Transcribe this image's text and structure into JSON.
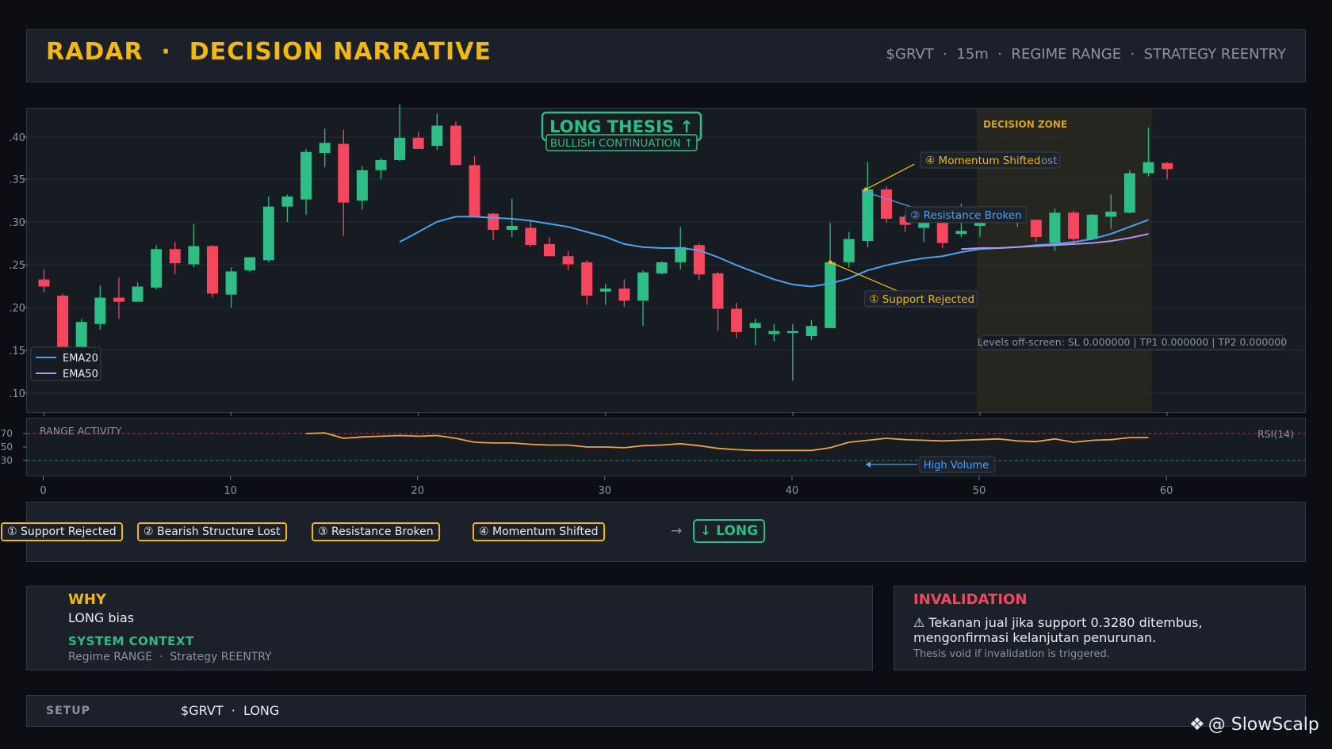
{
  "header": {
    "title": "RADAR  ·  DECISION NARRATIVE",
    "meta": "$GRVT  ·  15m  ·  REGIME RANGE  ·  STRATEGY REENTRY"
  },
  "colors": {
    "bull": "#2ebd85",
    "bear": "#f6465d",
    "ema20": "#4aa3f0",
    "ema50": "#b694f5",
    "accent": "#f0b90b",
    "rsi": "#f0a23c"
  },
  "chart_data": [
    {
      "type": "candlestick",
      "x_ticks": [
        "0",
        "10",
        "20",
        "30",
        "40",
        "50",
        "60"
      ],
      "y_tick_labels": [
        ".40",
        ".35",
        ".30",
        ".25",
        ".20",
        ".15",
        ".10"
      ],
      "ylim": [
        0.31,
        0.34
      ],
      "xlim": [
        -0.3,
        67
      ],
      "legend": {
        "placement": "bottom-left",
        "entries": [
          "EMA20",
          "EMA50"
        ]
      },
      "candles": [
        [
          0.3228,
          0.3238,
          0.3215,
          0.3221
        ],
        [
          0.3212,
          0.3214,
          0.3153,
          0.3161
        ],
        [
          0.3161,
          0.3189,
          0.3156,
          0.3186
        ],
        [
          0.3184,
          0.3222,
          0.3178,
          0.321
        ],
        [
          0.321,
          0.323,
          0.3189,
          0.3206
        ],
        [
          0.3206,
          0.3225,
          0.3206,
          0.3221
        ],
        [
          0.322,
          0.3262,
          0.3218,
          0.3258
        ],
        [
          0.3258,
          0.3265,
          0.3233,
          0.3244
        ],
        [
          0.3243,
          0.3283,
          0.324,
          0.3261
        ],
        [
          0.3261,
          0.3262,
          0.321,
          0.3214
        ],
        [
          0.3213,
          0.324,
          0.32,
          0.3236
        ],
        [
          0.3237,
          0.325,
          0.3235,
          0.325
        ],
        [
          0.3247,
          0.331,
          0.3245,
          0.33
        ],
        [
          0.33,
          0.3312,
          0.3285,
          0.331
        ],
        [
          0.3307,
          0.3357,
          0.3292,
          0.3354
        ],
        [
          0.3353,
          0.3377,
          0.3339,
          0.3363
        ],
        [
          0.3362,
          0.3376,
          0.3271,
          0.3304
        ],
        [
          0.3306,
          0.334,
          0.3297,
          0.3336
        ],
        [
          0.3336,
          0.3348,
          0.3327,
          0.3346
        ],
        [
          0.3346,
          0.3401,
          0.3345,
          0.3368
        ],
        [
          0.3368,
          0.3374,
          0.3357,
          0.3357
        ],
        [
          0.336,
          0.3392,
          0.3356,
          0.338
        ],
        [
          0.338,
          0.3384,
          0.3341,
          0.3341
        ],
        [
          0.3341,
          0.335,
          0.3289,
          0.329
        ],
        [
          0.3293,
          0.3294,
          0.3267,
          0.3277
        ],
        [
          0.3277,
          0.3308,
          0.327,
          0.3281
        ],
        [
          0.3279,
          0.3287,
          0.326,
          0.3262
        ],
        [
          0.3263,
          0.327,
          0.3253,
          0.3251
        ],
        [
          0.3251,
          0.3256,
          0.3237,
          0.3243
        ],
        [
          0.3245,
          0.3247,
          0.3203,
          0.3212
        ],
        [
          0.3216,
          0.3224,
          0.3203,
          0.3219
        ],
        [
          0.3219,
          0.3228,
          0.3201,
          0.3207
        ],
        [
          0.3207,
          0.3237,
          0.3182,
          0.3235
        ],
        [
          0.3234,
          0.3246,
          0.3233,
          0.3245
        ],
        [
          0.3245,
          0.328,
          0.3238,
          0.326
        ],
        [
          0.3262,
          0.3264,
          0.3227,
          0.3233
        ],
        [
          0.3234,
          0.3236,
          0.3177,
          0.3199
        ],
        [
          0.3199,
          0.3205,
          0.317,
          0.3176
        ],
        [
          0.318,
          0.3189,
          0.3163,
          0.3185
        ],
        [
          0.3174,
          0.3184,
          0.3167,
          0.3177
        ],
        [
          0.3175,
          0.3184,
          0.3128,
          0.3177
        ],
        [
          0.3172,
          0.3188,
          0.3168,
          0.3182
        ],
        [
          0.318,
          0.3284,
          0.318,
          0.3245
        ],
        [
          0.3245,
          0.3275,
          0.324,
          0.3268
        ],
        [
          0.3266,
          0.3344,
          0.326,
          0.3317
        ],
        [
          0.3317,
          0.332,
          0.3284,
          0.3288
        ],
        [
          0.329,
          0.3292,
          0.3275,
          0.3282
        ],
        [
          0.3279,
          0.3297,
          0.3265,
          0.3293
        ],
        [
          0.3293,
          0.3299,
          0.3259,
          0.3264
        ],
        [
          0.3273,
          0.3303,
          0.327,
          0.3276
        ],
        [
          0.3281,
          0.3294,
          0.327,
          0.3294
        ],
        [
          0.3294,
          0.3297,
          0.3284,
          0.3287
        ],
        [
          0.3288,
          0.33,
          0.328,
          0.3294
        ],
        [
          0.3287,
          0.3287,
          0.3265,
          0.327
        ],
        [
          0.3264,
          0.3298,
          0.3256,
          0.3294
        ],
        [
          0.3294,
          0.3296,
          0.3263,
          0.3268
        ],
        [
          0.3268,
          0.3293,
          0.3268,
          0.3292
        ],
        [
          0.329,
          0.3312,
          0.3278,
          0.3295
        ],
        [
          0.3294,
          0.3336,
          0.3293,
          0.3333
        ],
        [
          0.3333,
          0.3378,
          0.333,
          0.3344
        ],
        [
          0.3343,
          0.3344,
          0.3327,
          0.3337
        ]
      ],
      "ema20": [
        [
          19,
          0.3265
        ],
        [
          20,
          0.3275
        ],
        [
          21,
          0.3285
        ],
        [
          22,
          0.329
        ],
        [
          23,
          0.329
        ],
        [
          24,
          0.3289
        ],
        [
          25,
          0.3288
        ],
        [
          26,
          0.3286
        ],
        [
          27,
          0.3283
        ],
        [
          28,
          0.328
        ],
        [
          29,
          0.3275
        ],
        [
          30,
          0.327
        ],
        [
          31,
          0.3263
        ],
        [
          32,
          0.326
        ],
        [
          33,
          0.3259
        ],
        [
          34,
          0.3259
        ],
        [
          35,
          0.3257
        ],
        [
          36,
          0.325
        ],
        [
          37,
          0.3242
        ],
        [
          38,
          0.3235
        ],
        [
          39,
          0.3228
        ],
        [
          40,
          0.3223
        ],
        [
          41,
          0.3221
        ],
        [
          42,
          0.3224
        ],
        [
          43,
          0.3229
        ],
        [
          44,
          0.3237
        ],
        [
          45,
          0.3242
        ],
        [
          46,
          0.3246
        ],
        [
          47,
          0.3249
        ],
        [
          48,
          0.3251
        ],
        [
          49,
          0.3255
        ],
        [
          50,
          0.3258
        ],
        [
          51,
          0.3259
        ],
        [
          52,
          0.326
        ],
        [
          53,
          0.3262
        ],
        [
          54,
          0.3263
        ],
        [
          55,
          0.3265
        ],
        [
          56,
          0.3268
        ],
        [
          57,
          0.3273
        ],
        [
          58,
          0.328
        ],
        [
          59,
          0.3287
        ]
      ],
      "ema50": [
        [
          49,
          0.3258
        ],
        [
          50,
          0.3259
        ],
        [
          51,
          0.3259
        ],
        [
          52,
          0.326
        ],
        [
          53,
          0.3261
        ],
        [
          54,
          0.3262
        ],
        [
          55,
          0.3263
        ],
        [
          56,
          0.3264
        ],
        [
          57,
          0.3266
        ],
        [
          58,
          0.3269
        ],
        [
          59,
          0.3273
        ]
      ],
      "decision_zone": {
        "label": "DECISION ZONE",
        "x_range": [
          50,
          59
        ]
      },
      "thesis": {
        "title": "LONG THESIS  ↑",
        "subtitle": "BULLISH CONTINUATION ↑"
      },
      "annotations": [
        {
          "text": "① Support Rejected",
          "point": [
            42,
            0.3245
          ],
          "anchor": [
            45.8,
            0.3215
          ],
          "label": [
            44,
            0.3209
          ],
          "color": "#f0b90b"
        },
        {
          "text": "② Resistance Broken",
          "point": [
            43.8,
            0.3315
          ],
          "anchor": [
            47.6,
            0.3292
          ],
          "label": [
            46.2,
            0.3292
          ],
          "color": "#4aa3f0"
        },
        {
          "text": "④ Momentum Shifted",
          "overlap_text": "③ Bearish Structure Lost",
          "point": [
            43.9,
            0.3317
          ],
          "anchor": [
            46.5,
            0.3342
          ],
          "label": [
            47,
            0.3346
          ],
          "color": "#f0b90b"
        }
      ],
      "levels_note": "Levels off-screen: SL 0.000000 | TP1 0.000000 | TP2 0.000000"
    },
    {
      "type": "line",
      "title": "RANGE ACTIVITY",
      "ylabel": "RSI(14)",
      "ylim": [
        10,
        90
      ],
      "y_ticks": [
        "70",
        "50",
        "30"
      ],
      "levels": [
        70,
        30
      ],
      "x": [
        14,
        15,
        16,
        17,
        18,
        19,
        20,
        21,
        22,
        23,
        24,
        25,
        26,
        27,
        28,
        29,
        30,
        31,
        32,
        33,
        34,
        35,
        36,
        37,
        38,
        39,
        40,
        41,
        42,
        43,
        44,
        45,
        46,
        47,
        48,
        49,
        50,
        51,
        52,
        53,
        54,
        55,
        56,
        57,
        58,
        59
      ],
      "values": [
        70,
        71,
        63,
        65,
        66,
        67,
        66,
        67,
        63,
        57,
        56,
        56,
        54,
        53,
        53,
        50,
        50,
        49,
        52,
        53,
        55,
        52,
        48,
        46,
        45,
        45,
        45,
        45,
        49,
        57,
        60,
        63,
        61,
        60,
        59,
        60,
        61,
        62,
        59,
        58,
        62,
        57,
        60,
        61,
        64,
        64
      ],
      "annotation": {
        "text": "High Volume",
        "point": [
          43.9,
          -12
        ],
        "label": [
          46.9,
          -12
        ]
      }
    }
  ],
  "narrative": {
    "steps": [
      "① Support Rejected",
      "② Bearish Structure Lost",
      "③ Resistance Broken",
      "④ Momentum Shifted"
    ],
    "arrow": "→",
    "result": "↓ LONG"
  },
  "why": {
    "title": "WHY",
    "body": "LONG bias",
    "context_title": "SYSTEM CONTEXT",
    "context_body": "Regime RANGE  ·  Strategy REENTRY"
  },
  "invalidation": {
    "title": "INVALIDATION",
    "body": "⚠ Tekanan jual jika support 0.3280 ditembus, mengonfirmasi kelanjutan penurunan.",
    "note": "Thesis void if invalidation is triggered."
  },
  "setup": {
    "label": "SETUP",
    "value": "$GRVT  ·  LONG"
  },
  "watermark": {
    "logo": "❖",
    "text": "@ SlowScalp"
  }
}
